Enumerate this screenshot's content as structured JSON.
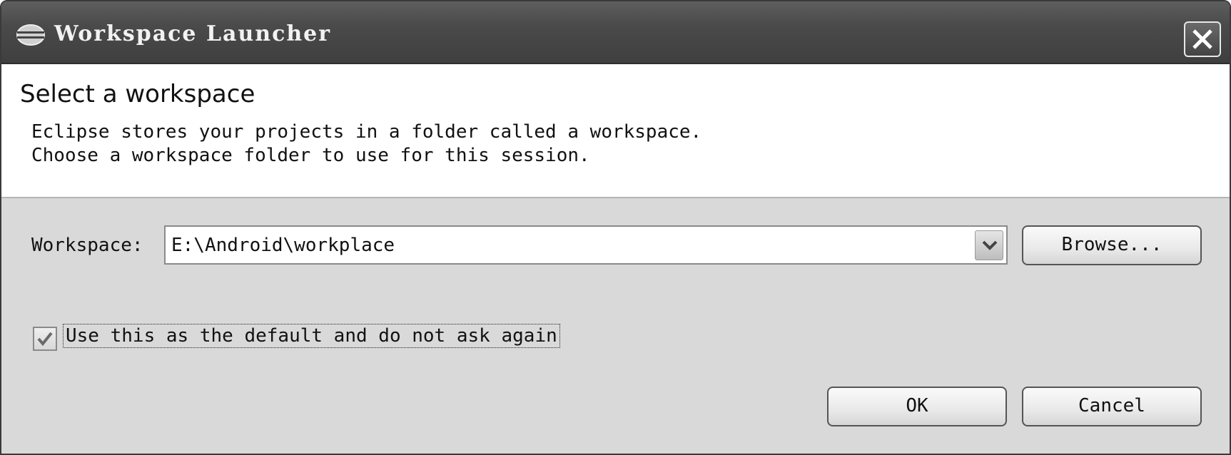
{
  "window": {
    "title": "Workspace Launcher"
  },
  "banner": {
    "title": "Select a workspace",
    "description_line1": "Eclipse stores your projects in a folder called a workspace.",
    "description_line2": "Choose a workspace folder to use for this session."
  },
  "workspace": {
    "label": "Workspace:",
    "value": "E:\\Android\\workplace",
    "browse_label": "Browse..."
  },
  "default_option": {
    "label": "Use this as the default and do not ask again",
    "checked": true
  },
  "actions": {
    "ok_label": "OK",
    "cancel_label": "Cancel"
  },
  "icons": {
    "app": "eclipse-icon",
    "close": "close-icon",
    "dropdown": "chevron-down-icon",
    "check": "checkmark-icon"
  },
  "colors": {
    "titlebar": "#4a4a4a",
    "banner_background": "#ffffff",
    "dialog_background": "#d9d9d9"
  }
}
